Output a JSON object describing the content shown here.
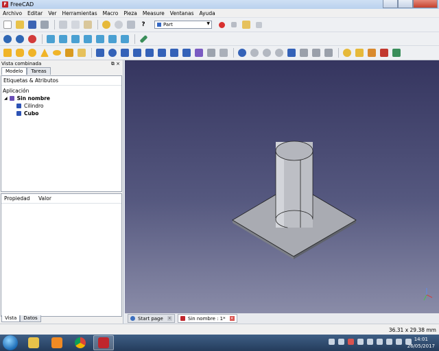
{
  "window": {
    "title": "FreeCAD"
  },
  "menu": [
    "Archivo",
    "Editar",
    "Ver",
    "Herramientas",
    "Macro",
    "Pieza",
    "Measure",
    "Ventanas",
    "Ayuda"
  ],
  "workbench": {
    "selected": "Part"
  },
  "combo": {
    "title": "Vista combinada",
    "tabs": [
      "Modelo",
      "Tareas"
    ],
    "tree_header": "Etiquetas & Atributos",
    "tree_root": "Aplicación",
    "document": "Sin nombre",
    "objects": [
      "Cilindro",
      "Cubo"
    ],
    "prop_columns": [
      "Propiedad",
      "Valor"
    ],
    "bottom_tabs": [
      "Vista",
      "Datos"
    ]
  },
  "doc_tabs": [
    {
      "label": "Start page"
    },
    {
      "label": "Sin nombre : 1*"
    }
  ],
  "status": {
    "dimensions": "36.31 x 29.38 mm"
  },
  "clock": {
    "time": "14:01",
    "date": "26/05/2017"
  },
  "colors": {
    "view_top": "#35355f",
    "view_bottom": "#8a8ca8",
    "accent": "#c0262d"
  },
  "icons": {
    "toolbar1": [
      "new-icon",
      "open-icon",
      "save-icon",
      "print-icon",
      "cut-icon",
      "copy-icon",
      "paste-icon",
      "undo-icon",
      "redo-icon",
      "refresh-icon",
      "whats-this-icon",
      "record-macro-icon",
      "stop-macro-icon",
      "edit-macro-icon",
      "run-macro-icon"
    ],
    "toolbar2": [
      "fit-all-icon",
      "fit-selection-icon",
      "draw-style-icon",
      "view-isometric-icon",
      "view-front-icon",
      "view-top-icon",
      "view-right-icon",
      "view-rear-icon",
      "view-bottom-icon",
      "view-left-icon",
      "measure-icon"
    ],
    "toolbar3": [
      "box-icon",
      "cylinder-icon",
      "sphere-icon",
      "cone-icon",
      "torus-icon",
      "primitives-icon",
      "shape-builder-icon",
      "extrude-icon",
      "revolve-icon",
      "mirror-icon",
      "fillet-icon",
      "chamfer-icon",
      "make-face-icon",
      "ruled-surface-icon",
      "loft-icon",
      "sweep-icon",
      "section-icon",
      "cross-sections-icon",
      "boolean-icon",
      "cut-icon",
      "fuse-icon",
      "common-icon",
      "join-icon",
      "split-icon",
      "compound-icon",
      "check-geometry-icon",
      "defeaturing-icon",
      "offset-icon",
      "thickness-icon",
      "projection-icon",
      "attachment-icon",
      "measure-linear-icon",
      "measure-angular-icon",
      "measure-refresh-icon",
      "measure-clear-icon",
      "measure-toggle-icon"
    ]
  }
}
